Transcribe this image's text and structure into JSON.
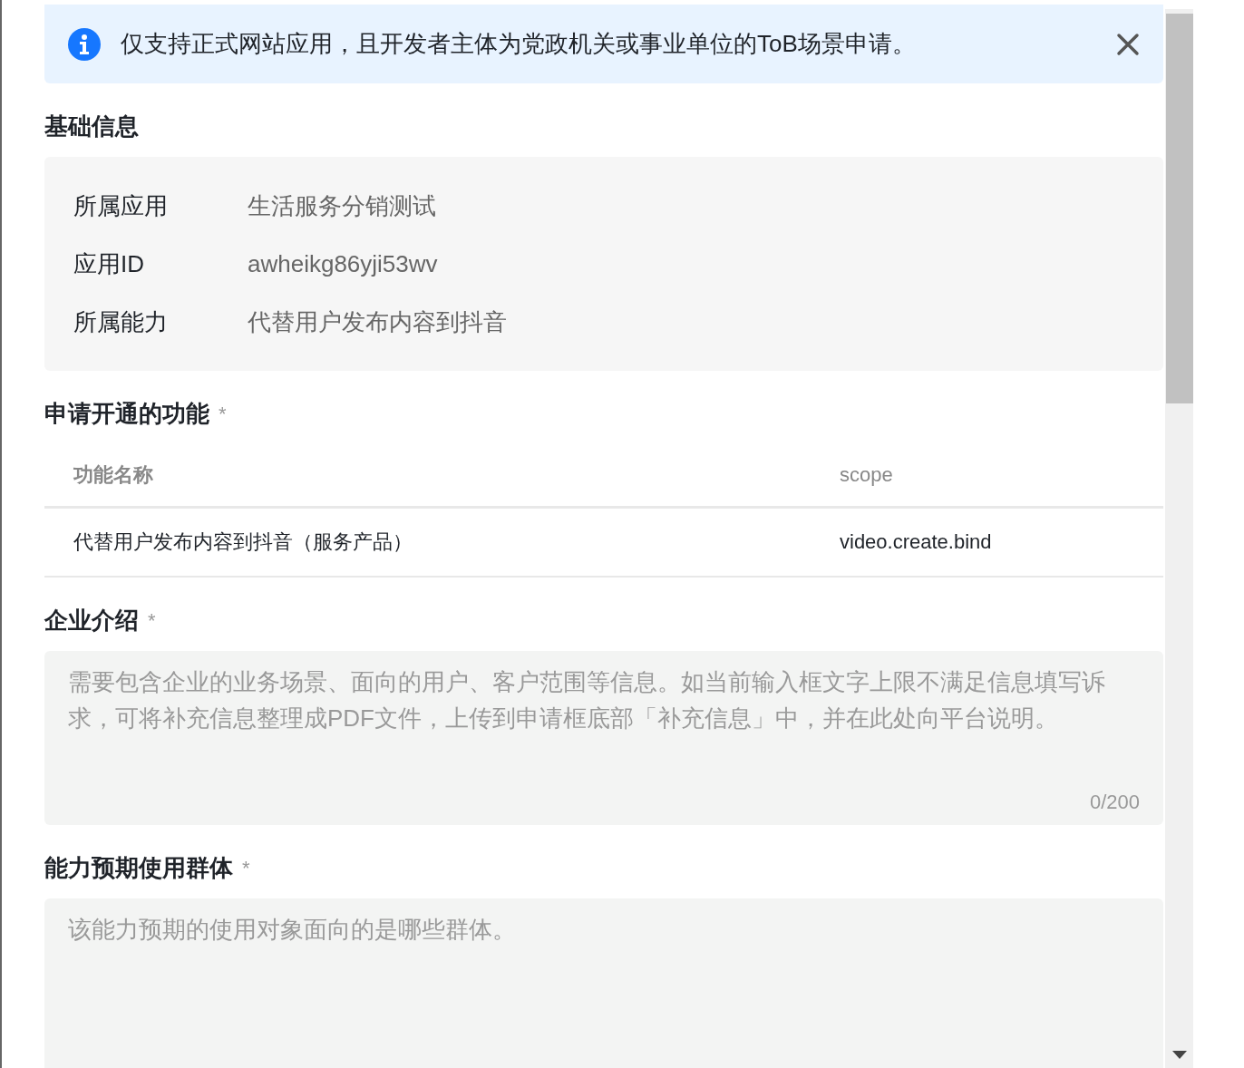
{
  "alert": {
    "text": "仅支持正式网站应用，且开发者主体为党政机关或事业单位的ToB场景申请。"
  },
  "sections": [
    {
      "kind": "info",
      "title": "基础信息",
      "rows": [
        {
          "label": "所属应用",
          "value": "生活服务分销测试"
        },
        {
          "label": "应用ID",
          "value": "awheikg86yji53wv"
        },
        {
          "label": "所属能力",
          "value": "代替用户发布内容到抖音"
        }
      ]
    },
    {
      "kind": "table",
      "title": "申请开通的功能",
      "required_mark": "*",
      "columns": [
        "功能名称",
        "scope"
      ],
      "rows": [
        [
          "代替用户发布内容到抖音（服务产品）",
          "video.create.bind"
        ]
      ]
    },
    {
      "kind": "textarea",
      "title": "企业介绍",
      "required_mark": "*",
      "placeholder": "需要包含企业的业务场景、面向的用户、客户范围等信息。如当前输入框文字上限不满足信息填写诉求，可将补充信息整理成PDF文件，上传到申请框底部「补充信息」中，并在此处向平台说明。",
      "counter": "0/200"
    },
    {
      "kind": "textarea",
      "title": "能力预期使用群体",
      "required_mark": "*",
      "placeholder": "该能力预期的使用对象面向的是哪些群体。"
    }
  ]
}
